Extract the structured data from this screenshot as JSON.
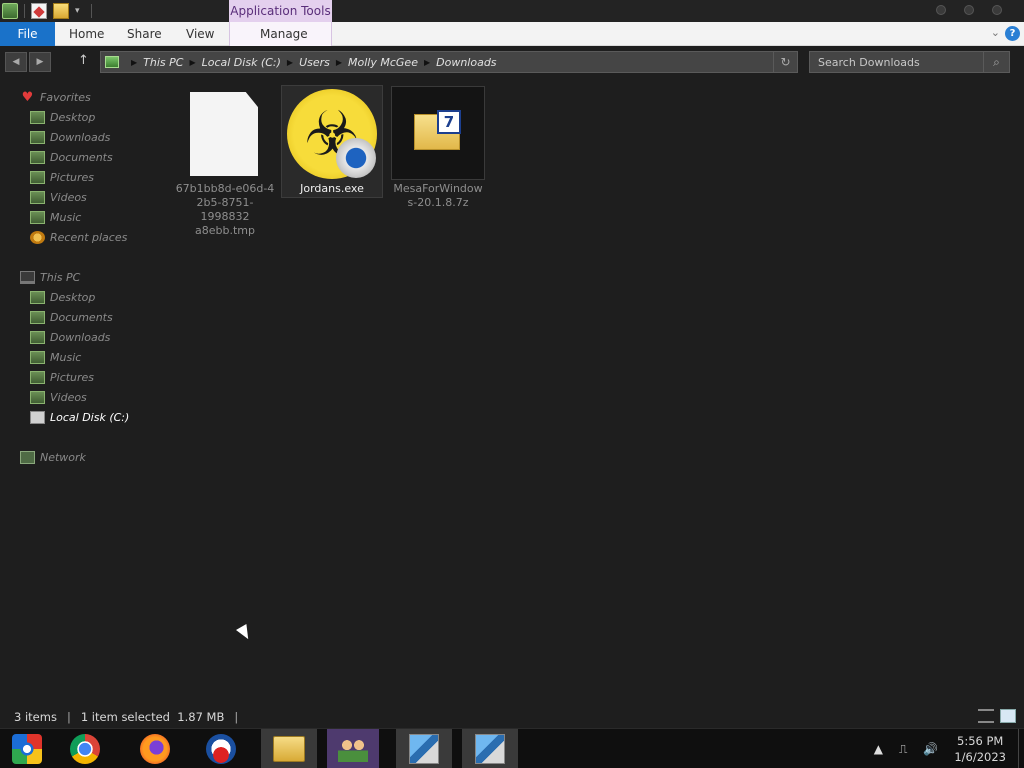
{
  "window": {
    "context_tab_title": "Application Tools",
    "window_controls": [
      "minimize",
      "maximize",
      "close"
    ]
  },
  "ribbon": {
    "file": "File",
    "tabs": [
      "Home",
      "Share",
      "View"
    ],
    "manage": "Manage",
    "help": "?"
  },
  "address": {
    "crumbs": [
      "This PC",
      "Local Disk (C:)",
      "Users",
      "Molly McGee",
      "Downloads"
    ],
    "refresh_icon": "refresh-icon"
  },
  "search": {
    "placeholder": "Search Downloads"
  },
  "sidebar": {
    "favorites": {
      "label": "Favorites",
      "items": [
        "Desktop",
        "Downloads",
        "Documents",
        "Pictures",
        "Videos",
        "Music",
        "Recent places"
      ]
    },
    "this_pc": {
      "label": "This PC",
      "items": [
        "Desktop",
        "Documents",
        "Downloads",
        "Music",
        "Pictures",
        "Videos",
        "Local Disk (C:)"
      ],
      "selected": "Local Disk (C:)"
    },
    "network": "Network"
  },
  "files": [
    {
      "name_line1": "67b1bb8d-e06d-4",
      "name_line2": "2b5-8751-1998832",
      "name_line3": "a8ebb.tmp",
      "icon": "blank-document-icon"
    },
    {
      "name_line1": "Jordans.exe",
      "icon": "biohazard-installer-icon",
      "selected": true
    },
    {
      "name_line1": "MesaForWindow",
      "name_line2": "s-20.1.8.7z",
      "icon": "7zip-archive-icon"
    }
  ],
  "status": {
    "count": "3 items",
    "selection": "1 item selected  1.87 MB"
  },
  "taskbar": {
    "apps": [
      "start-orb-icon",
      "chrome-icon",
      "firefox-icon",
      "obama-logo-icon",
      "file-explorer-icon",
      "people-app-icon",
      "setup-installer-icon",
      "setup-installer-icon"
    ]
  },
  "tray": {
    "time": "5:56 PM",
    "date": "1/6/2023"
  }
}
